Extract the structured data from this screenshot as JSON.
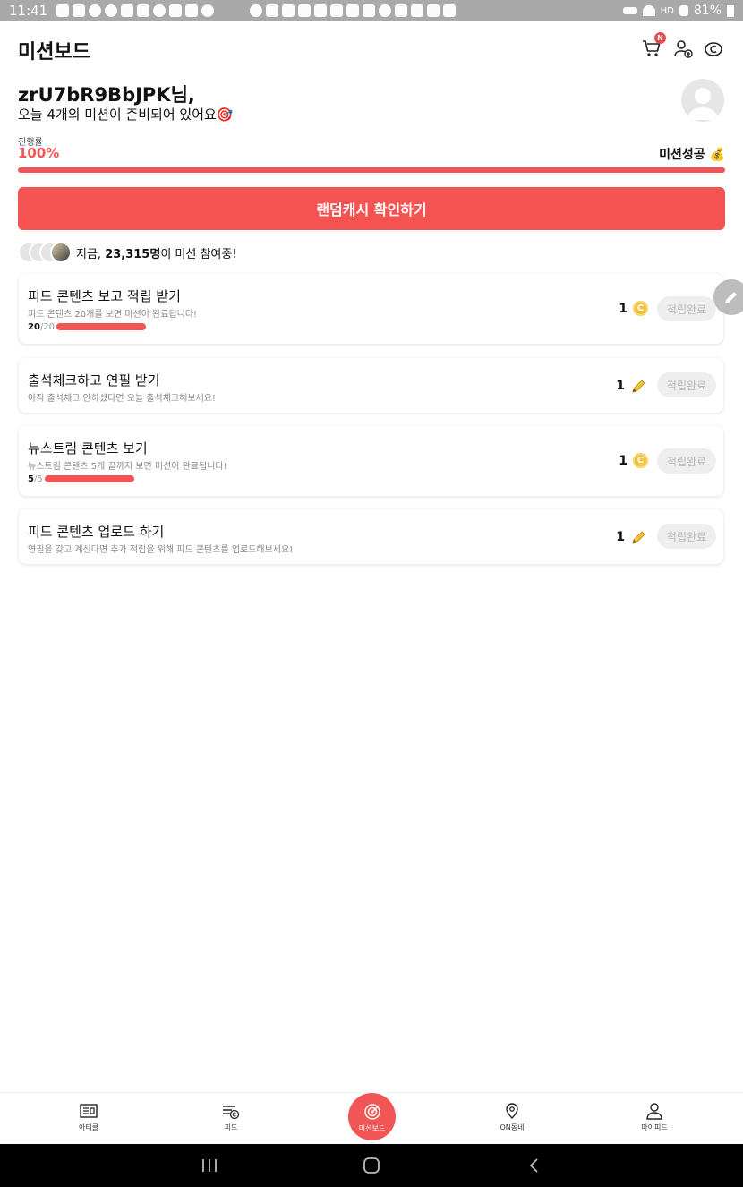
{
  "status_bar": {
    "time": "11:41",
    "battery": "81%",
    "network": "HD"
  },
  "header": {
    "title": "미션보드",
    "cart_badge": "N"
  },
  "greeting": {
    "name": "zrU7bR9BbJPK님,",
    "subtitle": "오늘 4개의 미션이 준비되어 있어요🎯"
  },
  "progress": {
    "label": "진행률",
    "value_text": "100%",
    "value": 1.0,
    "status": "미션성공 💰"
  },
  "cta_button": "랜덤캐시 확인하기",
  "participants": {
    "prefix": "지금, ",
    "count": "23,315명",
    "suffix": "이 미션 참여중!"
  },
  "missions": [
    {
      "title": "피드 콘텐츠 보고 적립 받기",
      "desc": "피드 콘텐츠 20개를 보면 미션이 완료됩니다!",
      "done": "20",
      "total": "/20",
      "reward": "1",
      "reward_icon": "coin-icon",
      "button": "적립완료"
    },
    {
      "title": "출석체크하고 연필 받기",
      "desc": "아직 출석체크 안하셨다면 오늘 출석체크해보세요!",
      "reward": "1",
      "reward_icon": "pencil-icon",
      "button": "적립완료"
    },
    {
      "title": "뉴스트림 콘텐츠 보기",
      "desc": "뉴스트림 콘텐츠 5개 끝까지 보면 미션이 완료됩니다!",
      "done": "5",
      "total": "/5",
      "reward": "1",
      "reward_icon": "coin-icon",
      "button": "적립완료"
    },
    {
      "title": "피드 콘텐츠 업로드 하기",
      "desc": "연필을 갖고 계신다면 추가 적립을 위해 피드 콘텐츠를 업로드해보세요!",
      "reward": "1",
      "reward_icon": "pencil-icon",
      "button": "적립완료"
    }
  ],
  "nav": {
    "article": "아티클",
    "feed": "피드",
    "mission": "미션보드",
    "on_town": "ON동네",
    "my_feed": "마이피드"
  },
  "colors": {
    "accent": "#f25555",
    "button_disabled_bg": "#eeeeee"
  }
}
